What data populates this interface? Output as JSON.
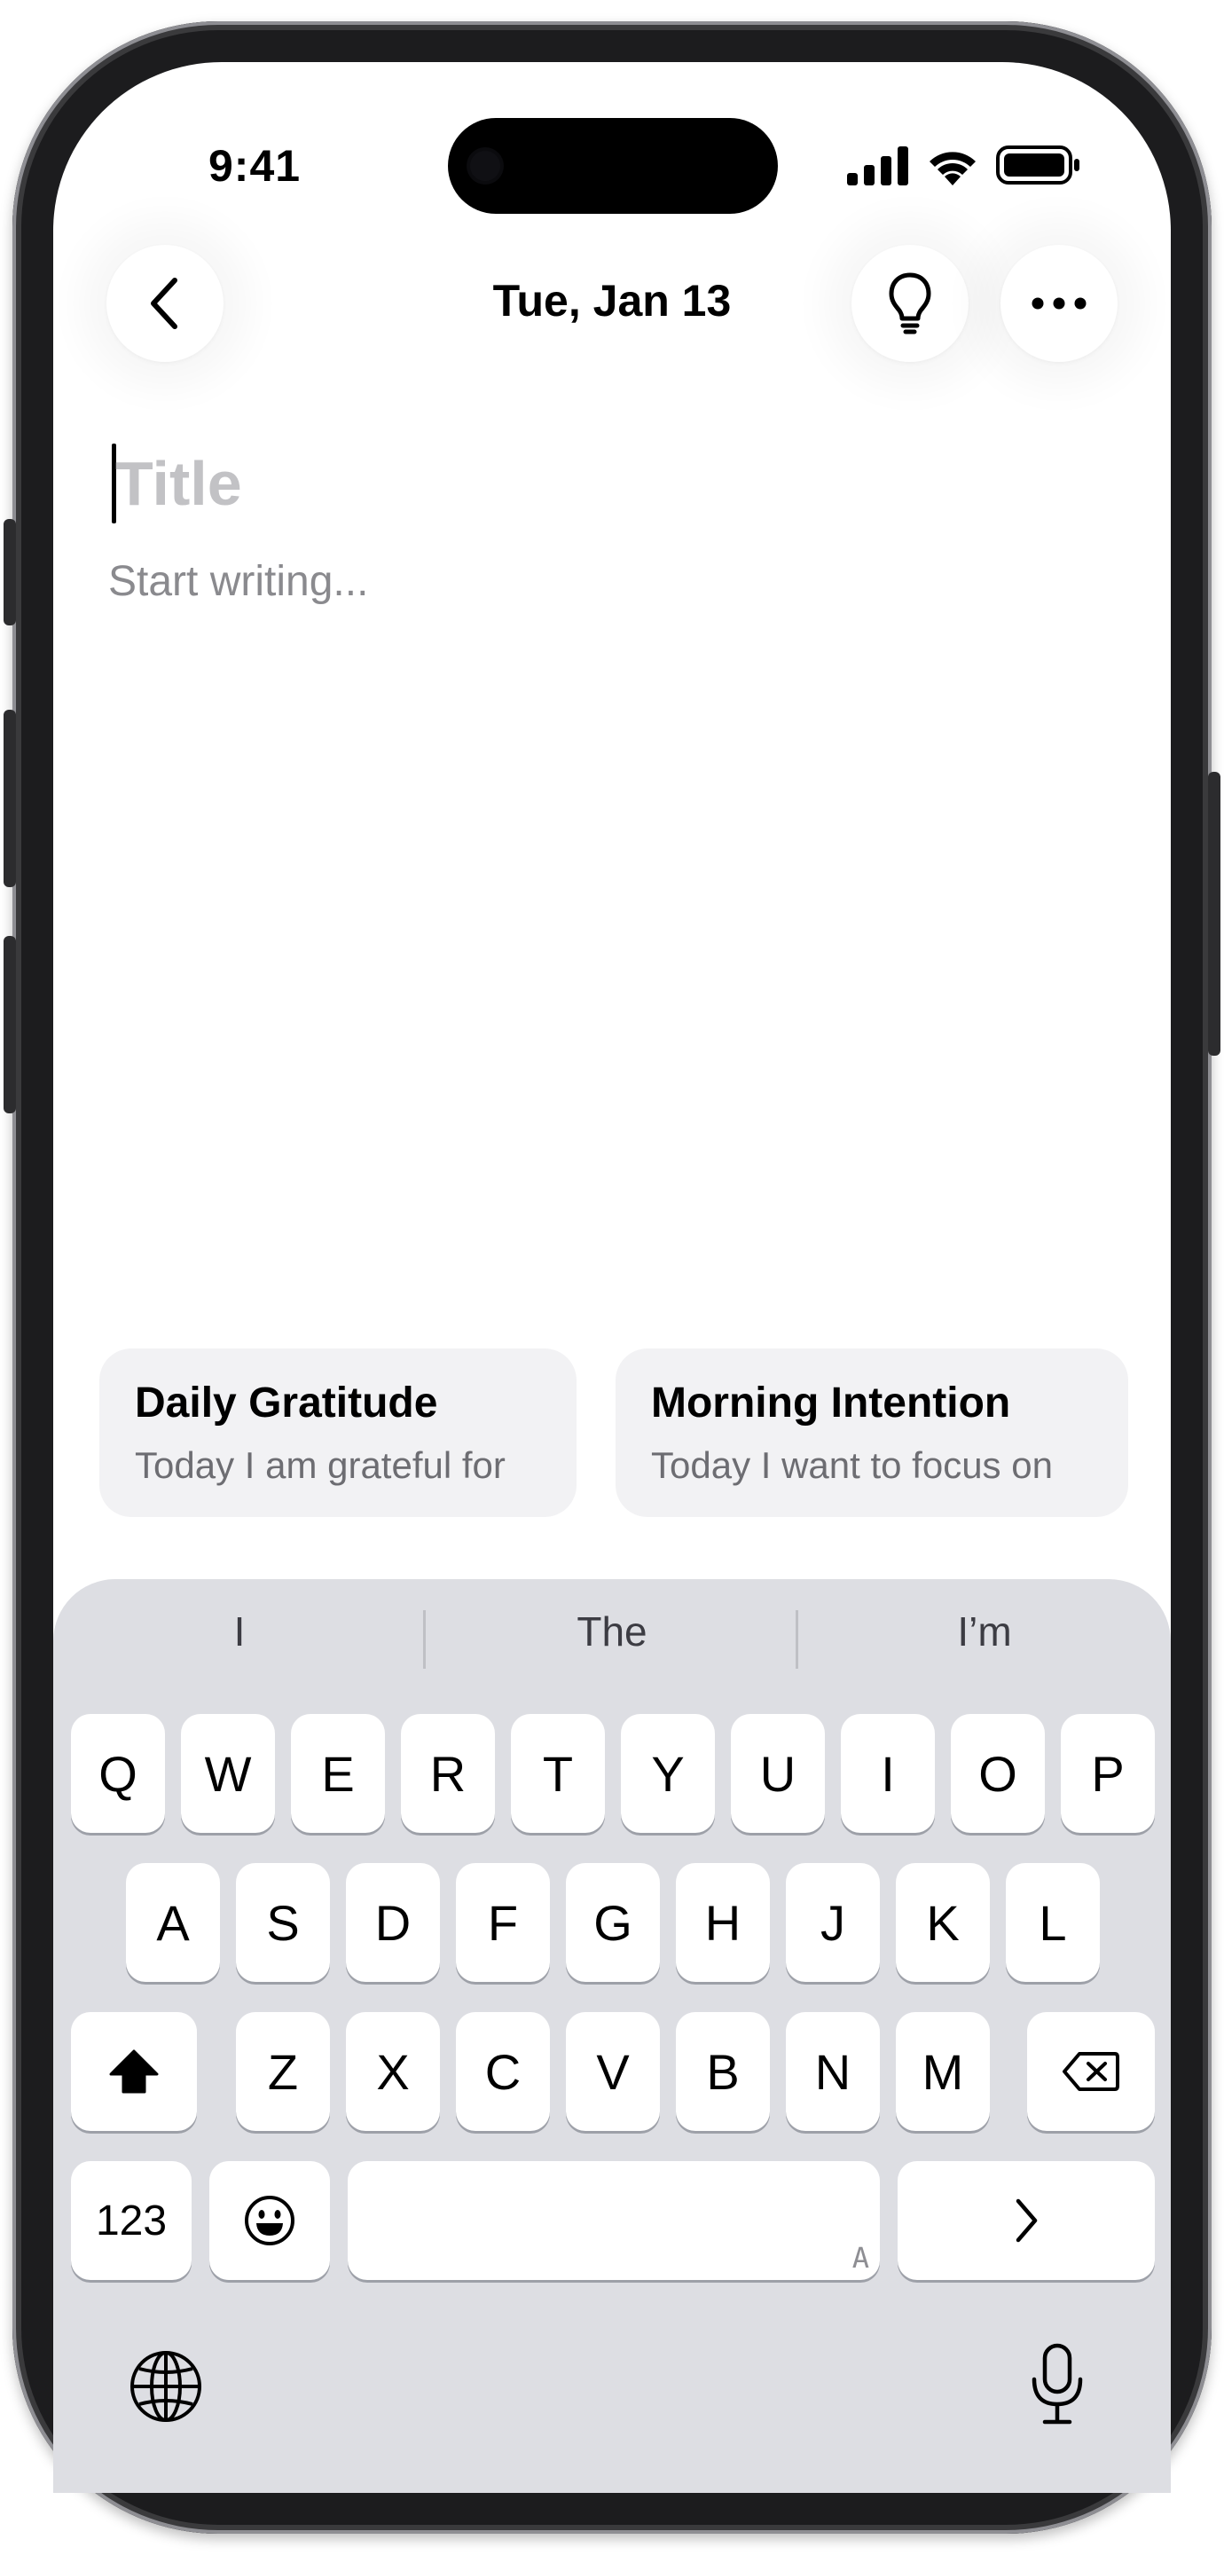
{
  "status_bar": {
    "time": "9:41"
  },
  "header": {
    "date": "Tue, Jan 13",
    "back_icon": "chevron-left-icon",
    "idea_icon": "lightbulb-icon",
    "more_icon": "ellipsis-icon"
  },
  "editor": {
    "title_placeholder": "Title",
    "body_placeholder": "Start writing..."
  },
  "suggestions": [
    {
      "title": "Daily Gratitude",
      "subtitle": "Today I am grateful for"
    },
    {
      "title": "Morning Intention",
      "subtitle": "Today I want to focus on"
    }
  ],
  "keyboard": {
    "predictions": [
      "I",
      "The",
      "I’m"
    ],
    "row1": [
      "Q",
      "W",
      "E",
      "R",
      "T",
      "Y",
      "U",
      "I",
      "O",
      "P"
    ],
    "row2": [
      "A",
      "S",
      "D",
      "F",
      "G",
      "H",
      "J",
      "K",
      "L"
    ],
    "row3": [
      "Z",
      "X",
      "C",
      "V",
      "B",
      "N",
      "M"
    ],
    "numbers_key": "123",
    "space_hint": "A",
    "return_icon": "chevron-right-icon",
    "shift_icon": "shift-icon",
    "delete_icon": "delete-icon",
    "emoji_icon": "emoji-icon",
    "globe_icon": "globe-icon",
    "mic_icon": "microphone-icon"
  },
  "colors": {
    "keyboard_bg": "#dddee3",
    "card_bg": "#f2f2f4",
    "placeholder": "#c2c2c5"
  }
}
